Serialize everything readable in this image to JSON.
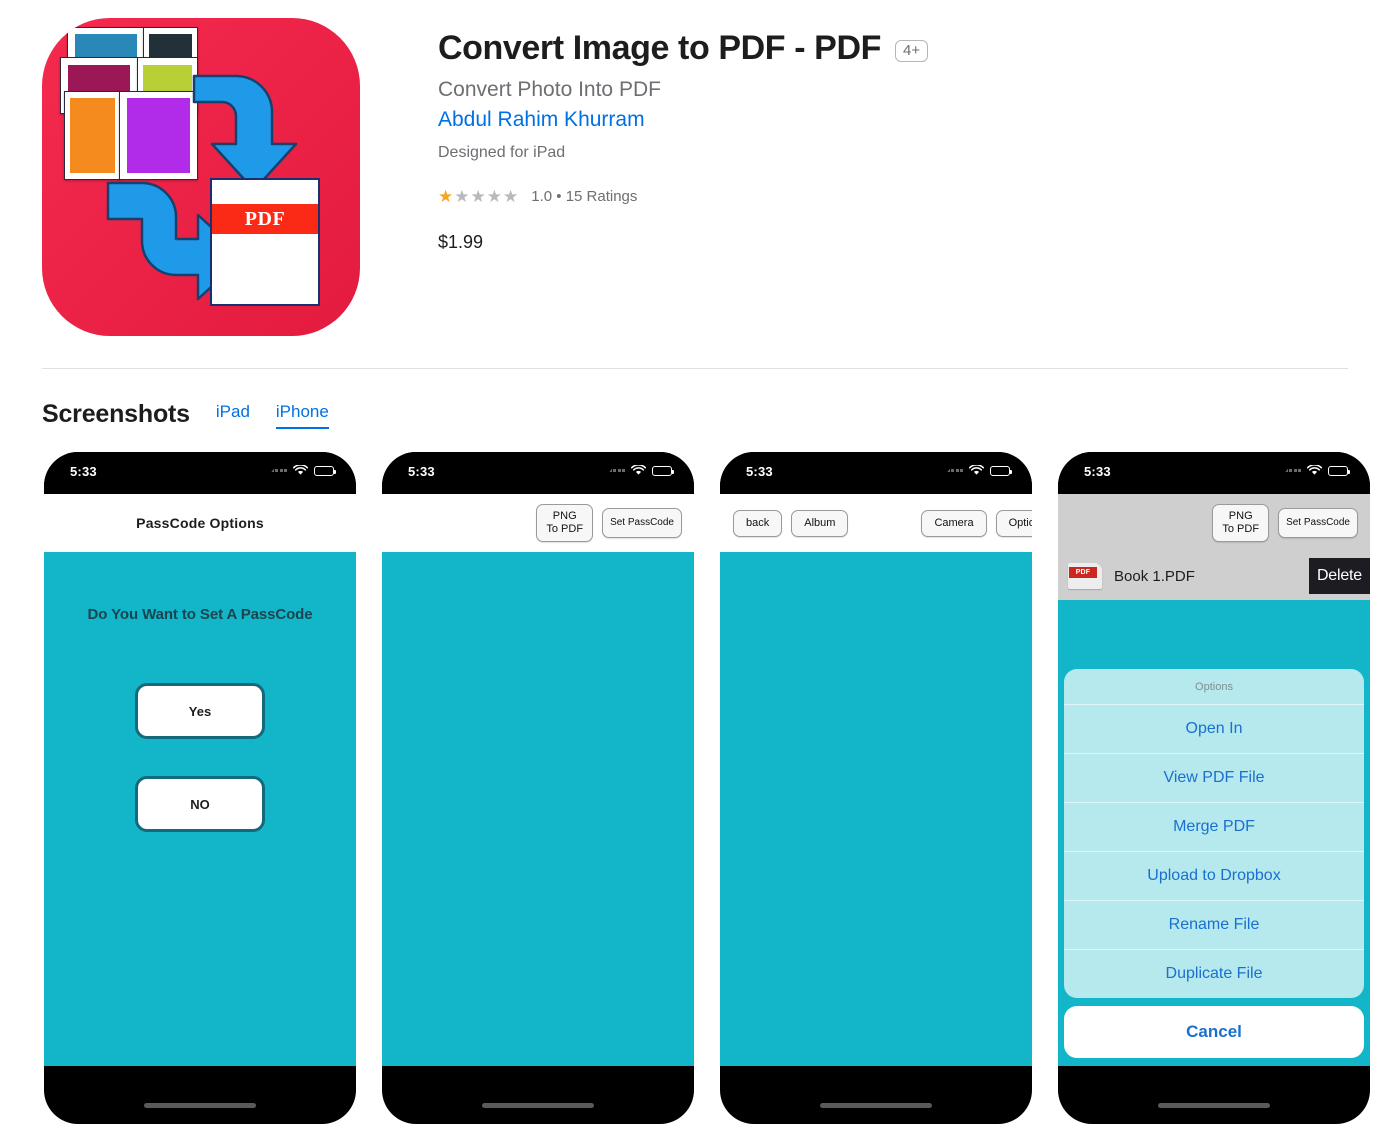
{
  "app": {
    "title": "Convert Image to PDF - PDF",
    "age_badge": "4+",
    "subtitle": "Convert Photo Into PDF",
    "developer": "Abdul Rahim Khurram",
    "designed_for": "Designed for iPad",
    "rating_value": "1.0",
    "rating_text": "1.0 • 15 Ratings",
    "stars_filled": 1,
    "stars_total": 5,
    "price": "$1.99",
    "icon": {
      "name": "convert-image-to-pdf-app-icon",
      "background_color": "#ee2447",
      "pdf_label": "PDF",
      "card_colors": [
        "#2a88b8",
        "#22303a",
        "#9c1756",
        "#b8cf35",
        "#f58b1e",
        "#b12ce8"
      ],
      "arrow_color": "#1e9ae8"
    }
  },
  "screenshots_section": {
    "title": "Screenshots",
    "tabs": [
      {
        "label": "iPad",
        "active": false
      },
      {
        "label": "iPhone",
        "active": true
      }
    ]
  },
  "accent_colors": {
    "link": "#0071e3",
    "app_teal": "#13b6c8",
    "sheet_blue": "#1a70cf",
    "star": "#f5a623"
  },
  "shots": [
    {
      "name": "passcode-options",
      "status_time": "5:33",
      "nav_title": "PassCode Options",
      "prompt": "Do You Want to Set A PassCode",
      "buttons": [
        {
          "label": "Yes"
        },
        {
          "label": "NO"
        }
      ]
    },
    {
      "name": "png-to-pdf-home",
      "status_time": "5:33",
      "toolbar_buttons": [
        {
          "label": "PNG\nTo PDF"
        },
        {
          "label": "Set PassCode"
        }
      ]
    },
    {
      "name": "camera-album-picker",
      "status_time": "5:33",
      "left_buttons": [
        {
          "label": "back"
        },
        {
          "label": "Album"
        }
      ],
      "right_buttons": [
        {
          "label": "Camera"
        },
        {
          "label": "Option"
        }
      ]
    },
    {
      "name": "file-options-sheet",
      "status_time": "5:33",
      "toolbar_buttons": [
        {
          "label": "PNG\nTo PDF"
        },
        {
          "label": "Set PassCode"
        }
      ],
      "file_row": {
        "icon_label": "PDF",
        "name": "Book 1.PDF",
        "delete_label": "Delete"
      },
      "sheet": {
        "title": "Options",
        "items": [
          {
            "label": "Open In"
          },
          {
            "label": "View PDF File"
          },
          {
            "label": "Merge PDF"
          },
          {
            "label": "Upload to Dropbox"
          },
          {
            "label": "Rename File"
          },
          {
            "label": "Duplicate File"
          }
        ],
        "cancel_label": "Cancel"
      }
    }
  ]
}
